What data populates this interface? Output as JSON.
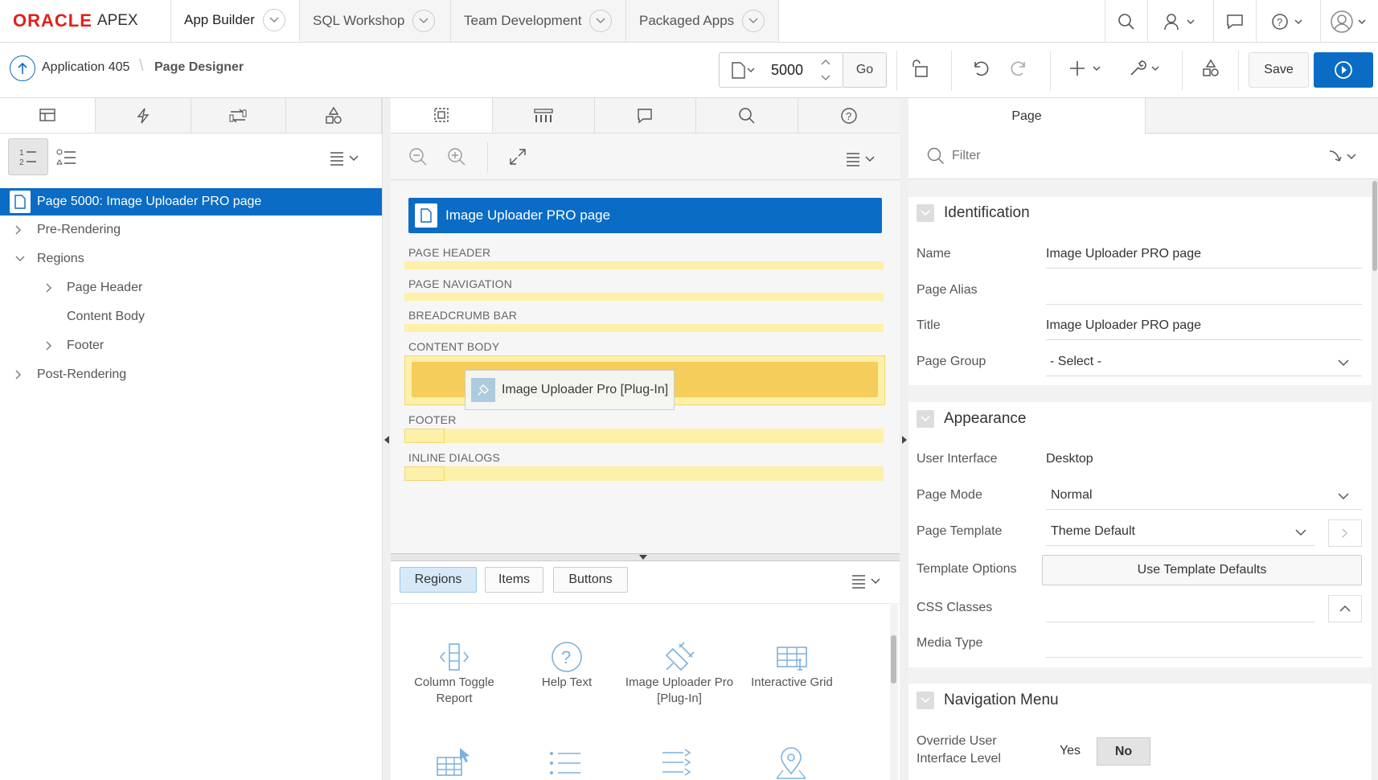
{
  "brand": {
    "oracle": "ORACLE",
    "apex": "APEX"
  },
  "nav": {
    "tabs": [
      "App Builder",
      "SQL Workshop",
      "Team Development",
      "Packaged Apps"
    ]
  },
  "toolbar": {
    "app": "Application 405",
    "page_designer": "Page Designer",
    "page_number": "5000",
    "go": "Go",
    "save": "Save"
  },
  "left": {
    "tree": [
      {
        "label": "Page 5000: Image Uploader PRO page"
      },
      {
        "label": "Pre-Rendering"
      },
      {
        "label": "Regions"
      },
      {
        "label": "Page Header"
      },
      {
        "label": "Content Body"
      },
      {
        "label": "Footer"
      },
      {
        "label": "Post-Rendering"
      }
    ]
  },
  "layout": {
    "page_title": "Image Uploader PRO page",
    "positions": [
      "PAGE HEADER",
      "PAGE NAVIGATION",
      "BREADCRUMB BAR",
      "CONTENT BODY",
      "FOOTER",
      "INLINE DIALOGS"
    ],
    "drag_item": "Image Uploader Pro [Plug-In]"
  },
  "gallery": {
    "tabs": [
      "Regions",
      "Items",
      "Buttons"
    ],
    "items": [
      {
        "label": "Column Toggle Report",
        "icon": "column-toggle-icon"
      },
      {
        "label": "Help Text",
        "icon": "help-icon"
      },
      {
        "label": "Image Uploader Pro [Plug-In]",
        "icon": "plugin-icon"
      },
      {
        "label": "Interactive Grid",
        "icon": "grid-icon"
      }
    ]
  },
  "props": {
    "tab": "Page",
    "filter_placeholder": "Filter",
    "identification": {
      "title": "Identification",
      "name_label": "Name",
      "name": "Image Uploader PRO page",
      "alias_label": "Page Alias",
      "title_label": "Title",
      "title_val": "Image Uploader PRO page",
      "group_label": "Page Group",
      "group": "- Select -"
    },
    "appearance": {
      "title": "Appearance",
      "ui_label": "User Interface",
      "ui": "Desktop",
      "mode_label": "Page Mode",
      "mode": "Normal",
      "template_label": "Page Template",
      "template": "Theme Default",
      "options_label": "Template Options",
      "options_btn": "Use Template Defaults",
      "css_label": "CSS Classes",
      "media_label": "Media Type"
    },
    "navmenu": {
      "title": "Navigation Menu",
      "override_label_1": "Override User",
      "override_label_2": "Interface Level",
      "yes": "Yes",
      "no": "No"
    }
  }
}
